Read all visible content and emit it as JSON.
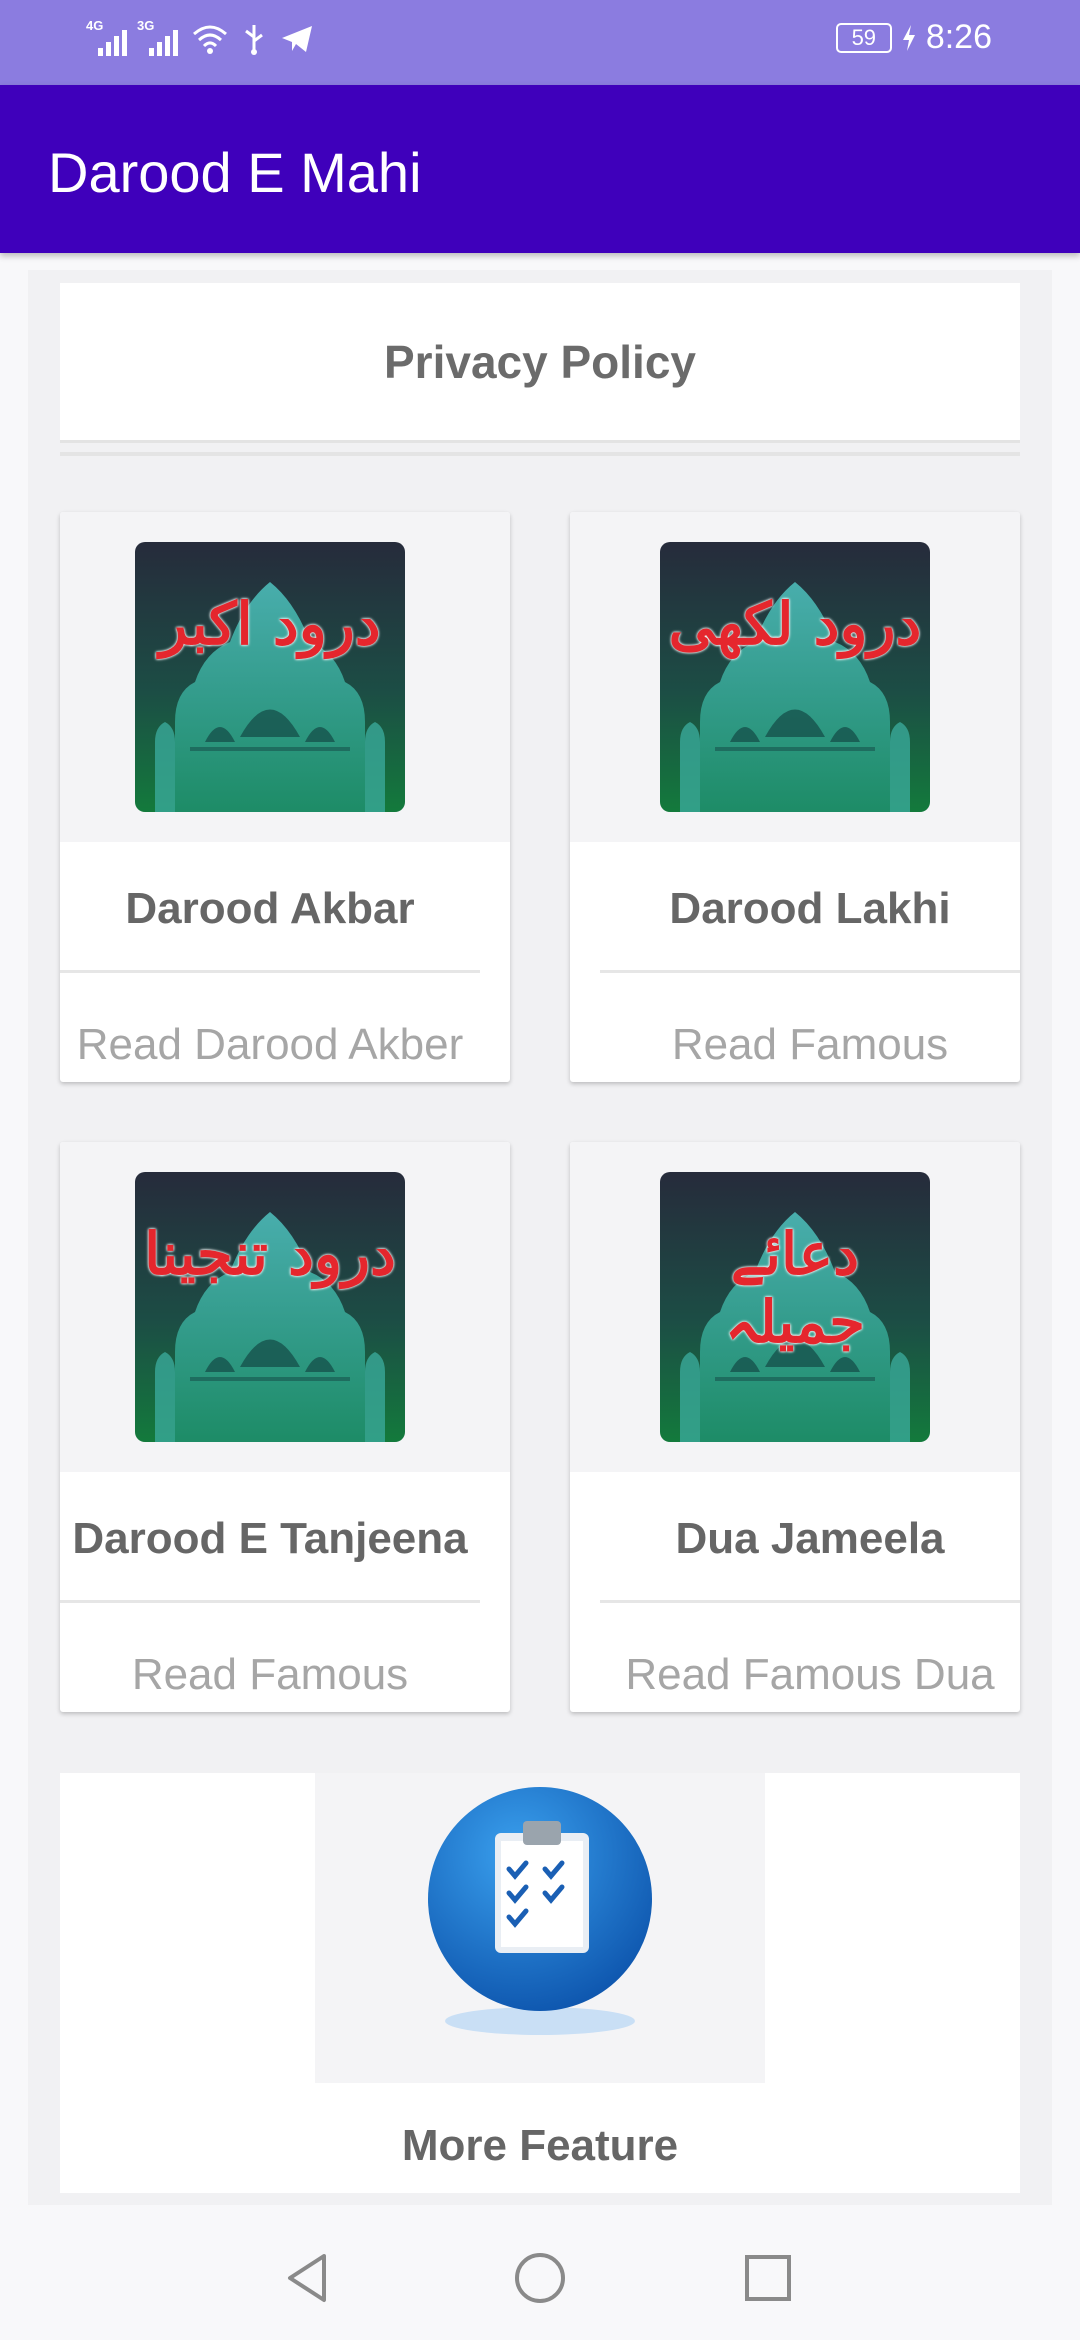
{
  "status_bar": {
    "network_1": "4G",
    "network_2": "3G",
    "battery": "59",
    "time": "8:26"
  },
  "app_bar": {
    "title": "Darood E Mahi"
  },
  "privacy": {
    "label": "Privacy Policy"
  },
  "cards": [
    {
      "urdu": "درود اکبر",
      "title": "Darood Akbar",
      "subtitle": "Read Darood Akber"
    },
    {
      "urdu": "درود لکھی",
      "title": "Darood Lakhi",
      "subtitle": "Read Famous"
    },
    {
      "urdu": "درود تنجینا",
      "title": "Darood E Tanjeena",
      "subtitle": "Read Famous"
    },
    {
      "urdu": "دعائے جمیلہ",
      "title": "Dua Jameela",
      "subtitle": "Read Famous Dua"
    }
  ],
  "more": {
    "label": "More Feature"
  },
  "nav": {
    "icons": [
      "back-icon",
      "home-icon",
      "recents-icon"
    ]
  },
  "colors": {
    "status_bar": "#8b7ce0",
    "app_bar": "#3f00bb",
    "urdu_text": "#e5262d",
    "tile_green": "#137a3c"
  }
}
